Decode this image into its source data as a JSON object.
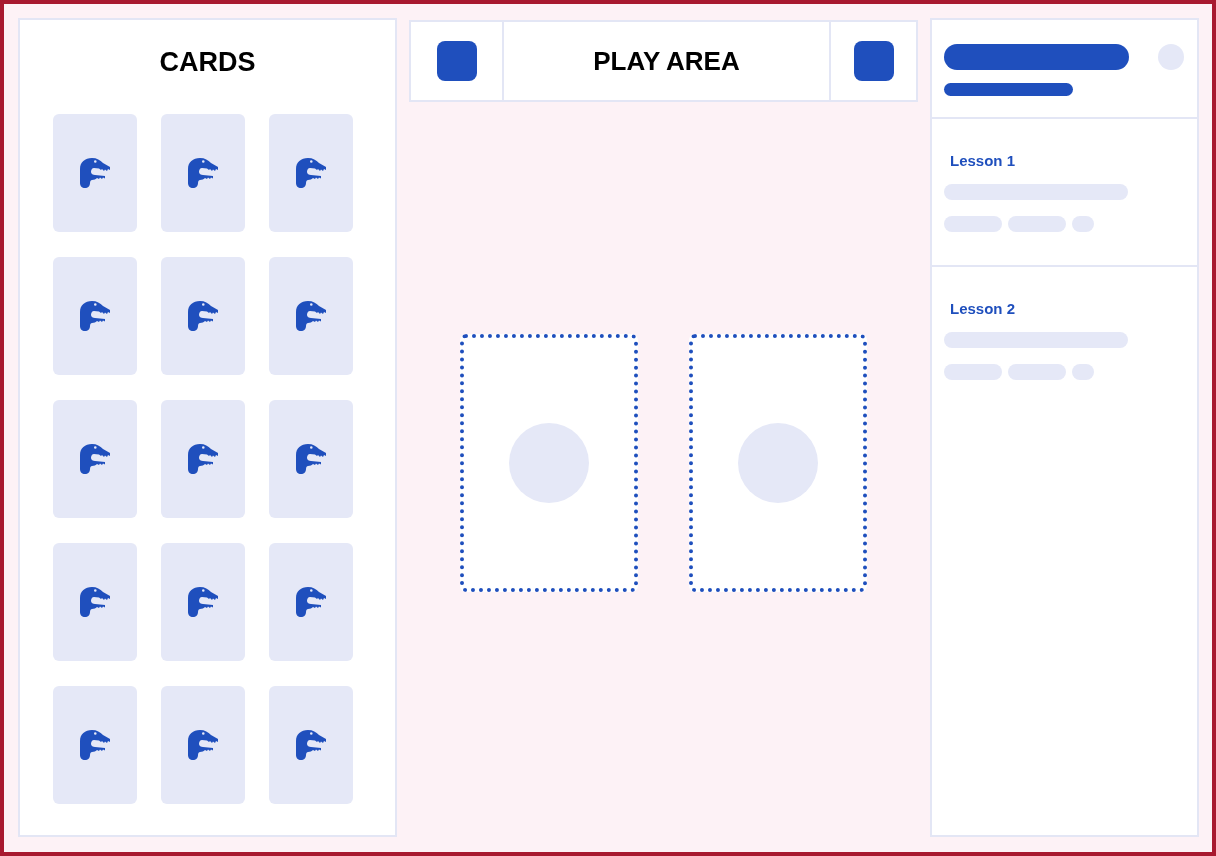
{
  "cards_panel": {
    "title": "CARDS",
    "cards": [
      {
        "kind": "dino"
      },
      {
        "kind": "dino"
      },
      {
        "kind": "dino"
      },
      {
        "kind": "dino"
      },
      {
        "kind": "dino"
      },
      {
        "kind": "dino"
      },
      {
        "kind": "dino"
      },
      {
        "kind": "dino"
      },
      {
        "kind": "dino"
      },
      {
        "kind": "dino"
      },
      {
        "kind": "dino"
      },
      {
        "kind": "dino"
      },
      {
        "kind": "dino"
      },
      {
        "kind": "dino"
      },
      {
        "kind": "dino"
      }
    ]
  },
  "play_area": {
    "title": "PLAY AREA",
    "drop_zones": [
      {
        "kind": "empty"
      },
      {
        "kind": "empty"
      }
    ]
  },
  "lessons_panel": {
    "lessons": [
      {
        "title": "Lesson 1"
      },
      {
        "title": "Lesson 2"
      }
    ]
  }
}
